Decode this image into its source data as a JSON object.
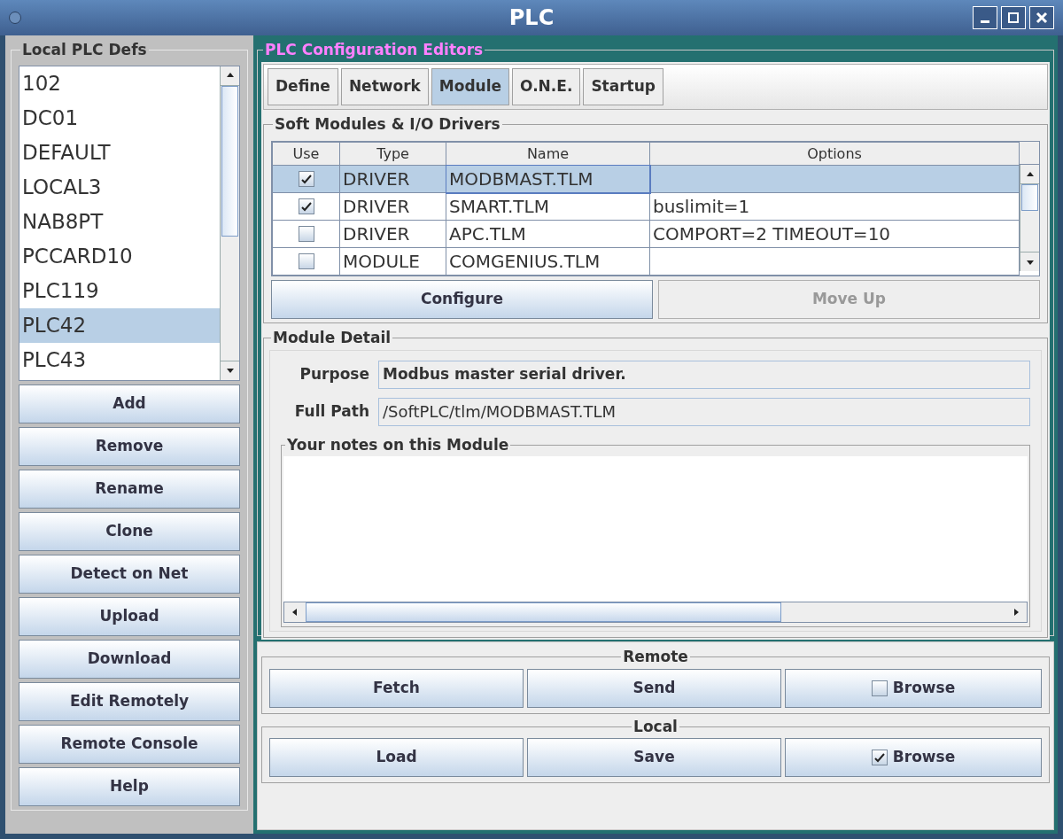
{
  "window": {
    "title": "PLC"
  },
  "plc_defs": {
    "title": "Local PLC Defs",
    "items": [
      {
        "label": "102",
        "selected": false
      },
      {
        "label": "DC01",
        "selected": false
      },
      {
        "label": "DEFAULT",
        "selected": false
      },
      {
        "label": "LOCAL3",
        "selected": false
      },
      {
        "label": "NAB8PT",
        "selected": false
      },
      {
        "label": "PCCARD10",
        "selected": false
      },
      {
        "label": "PLC119",
        "selected": false
      },
      {
        "label": "PLC42",
        "selected": true
      },
      {
        "label": "PLC43",
        "selected": false
      }
    ],
    "buttons": [
      "Add",
      "Remove",
      "Rename",
      "Clone",
      "Detect on Net",
      "Upload",
      "Download",
      "Edit Remotely",
      "Remote Console",
      "Help"
    ]
  },
  "editors": {
    "title": "PLC Configuration Editors",
    "tabs": [
      {
        "label": "Define",
        "selected": false
      },
      {
        "label": "Network",
        "selected": false
      },
      {
        "label": "Module",
        "selected": true
      },
      {
        "label": "O.N.E.",
        "selected": false
      },
      {
        "label": "Startup",
        "selected": false
      }
    ],
    "soft_modules": {
      "title": "Soft Modules & I/O Drivers",
      "columns": [
        "Use",
        "Type",
        "Name",
        "Options"
      ],
      "rows": [
        {
          "use": true,
          "type": "DRIVER",
          "name": "MODBMAST.TLM",
          "selected": true
        },
        {
          "use": true,
          "type": "DRIVER",
          "name": "SMART.TLM",
          "options": "buslimit=1",
          "selected": false
        },
        {
          "use": false,
          "type": "DRIVER",
          "name": "APC.TLM",
          "options": "COMPORT=2  TIMEOUT=10",
          "selected": false
        },
        {
          "use": false,
          "type": "MODULE",
          "name": "COMGENIUS.TLM",
          "selected": false
        }
      ],
      "buttons": [
        {
          "label": "Configure",
          "disabled": false
        },
        {
          "label": "Move Up",
          "disabled": true
        }
      ]
    },
    "module_detail": {
      "title": "Module Detail",
      "purpose_label": "Purpose",
      "purpose": "Modbus master serial driver.",
      "path_label": "Full Path",
      "path": "/SoftPLC/tlm/MODBMAST.TLM",
      "notes_title": "Your notes on this Module"
    }
  },
  "transfer": [
    {
      "title": "Remote",
      "buttons": [
        "Fetch",
        "Send"
      ],
      "browse": {
        "label": "Browse",
        "checked": false
      }
    },
    {
      "title": "Local",
      "buttons": [
        "Load",
        "Save"
      ],
      "browse": {
        "label": "Browse",
        "checked": true
      }
    }
  ]
}
